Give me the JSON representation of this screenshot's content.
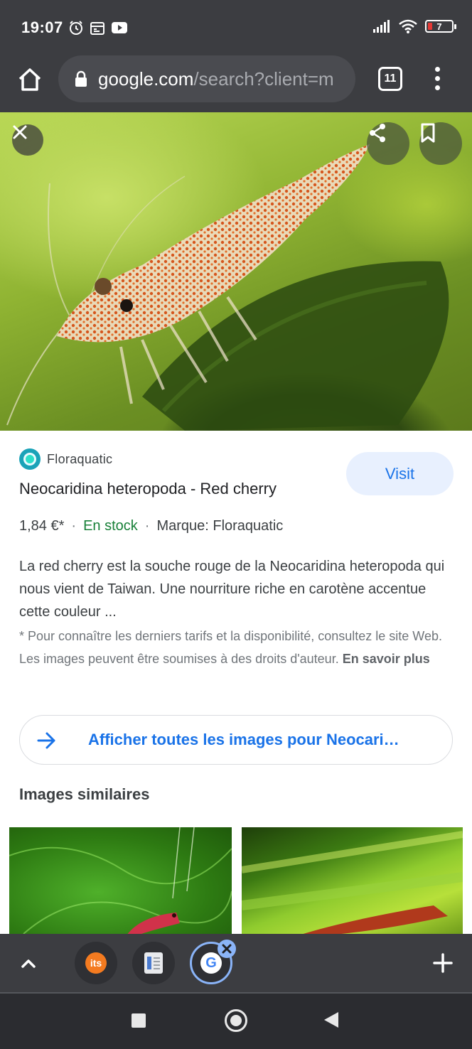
{
  "status_bar": {
    "time": "19:07",
    "battery": "7",
    "icons": [
      "alarm-icon",
      "calendar-icon",
      "youtube-icon",
      "signal-icon",
      "wifi-icon",
      "battery-icon"
    ]
  },
  "toolbar": {
    "url_domain": "google.com",
    "url_rest": "/search?client=m",
    "tab_count": "11"
  },
  "product": {
    "source": "Floraquatic",
    "visit_label": "Visit",
    "title": "Neocaridina heteropoda - Red cherry",
    "price": "1,84 €*",
    "stock": "En stock",
    "brand": "Marque: Floraquatic",
    "description": "La red cherry est la souche rouge de la Neocaridina heteropoda qui nous vient de Taiwan. Une nourriture riche en carotène accentue cette couleur ...",
    "note": "* Pour connaître les derniers tarifs et la disponibilité, consultez le site Web. Les images peuvent être soumises à des droits d'auteur.",
    "learn_more": "En savoir plus"
  },
  "all_images": {
    "label": "Afficher toutes les images pour Neocari…"
  },
  "similar": {
    "heading": "Images similaires"
  },
  "tab_strip": {
    "tabs": [
      {
        "label": "its",
        "icon": "its-favicon"
      },
      {
        "label": "",
        "icon": "document-favicon"
      },
      {
        "label": "G",
        "icon": "google-favicon"
      }
    ]
  },
  "colors": {
    "accent": "#1a73e8",
    "stock": "#188038",
    "chrome_bg": "#3c3d41"
  }
}
